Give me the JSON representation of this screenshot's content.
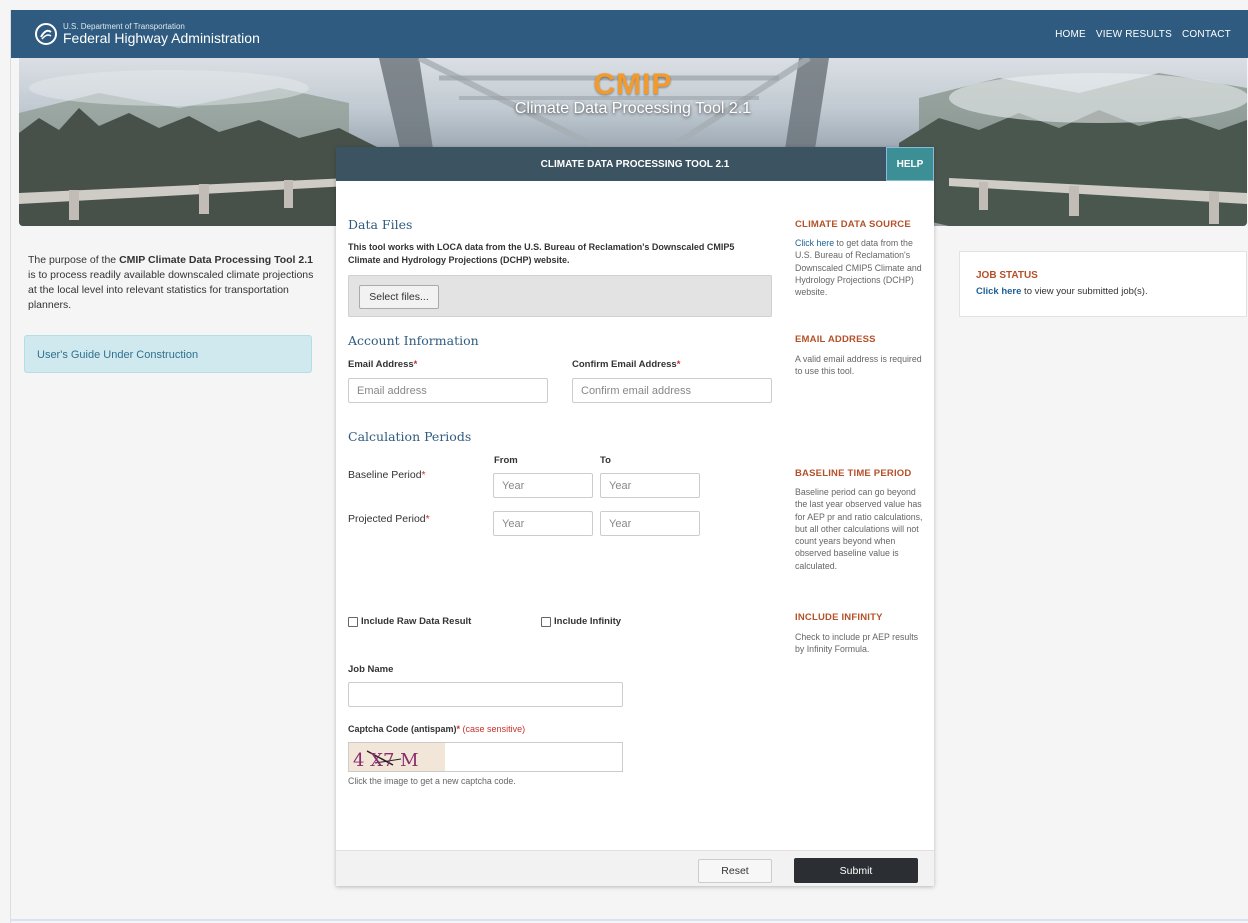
{
  "header": {
    "agency_small": "U.S. Department of Transportation",
    "agency_big": "Federal Highway Administration",
    "nav": [
      "HOME",
      "VIEW RESULTS",
      "CONTACT"
    ]
  },
  "hero": {
    "title": "CMIP",
    "subtitle": "Climate Data Processing Tool 2.1"
  },
  "left": {
    "intro_pre": "The purpose of the ",
    "intro_bold": "CMIP Climate Data Processing Tool 2.1",
    "intro_post": " is to process readily available downscaled climate projections at the local level into relevant statistics for transportation planners.",
    "guide": "User's Guide Under Construction"
  },
  "job_status": {
    "heading": "JOB STATUS",
    "link": "Click here",
    "text": " to view your submitted job(s)."
  },
  "panel": {
    "title": "CLIMATE DATA PROCESSING TOOL 2.1",
    "help": "HELP",
    "data_files": {
      "title": "Data Files",
      "desc": "This tool works with LOCA data from the U.S. Bureau of Reclamation's Downscaled CMIP5 Climate and Hydrology Projections (DCHP) website.",
      "select_button": "Select files..."
    },
    "account": {
      "title": "Account Information",
      "email_label": "Email Address",
      "email_placeholder": "Email address",
      "confirm_label": "Confirm Email Address",
      "confirm_placeholder": "Confirm email address",
      "required_mark": "*"
    },
    "periods": {
      "title": "Calculation Periods",
      "from": "From",
      "to": "To",
      "baseline_label": "Baseline Period",
      "projected_label": "Projected Period",
      "year_placeholder": "Year"
    },
    "options": {
      "raw": "Include Raw Data Result",
      "infinity": "Include Infinity"
    },
    "job_name": {
      "label": "Job Name",
      "value": ""
    },
    "captcha": {
      "label": "Captcha Code (antispam)",
      "case_note": "(case sensitive)",
      "code": "4 X7 M",
      "hint": "Click the image to get a new captcha code."
    },
    "buttons": {
      "reset": "Reset",
      "submit": "Submit"
    },
    "sidebar": {
      "source_head": "CLIMATE DATA SOURCE",
      "source_link": "Click here",
      "source_text": " to get data from the U.S. Bureau of Reclamation's Downscaled CMIP5 Climate and Hydrology Projections (DCHP) website.",
      "email_head": "EMAIL ADDRESS",
      "email_text": "A valid email address is required to use this tool.",
      "baseline_head": "BASELINE TIME PERIOD",
      "baseline_text": "Baseline period can go beyond the last year observed value has for AEP pr and ratio calculations, but all other calculations will not count years beyond when observed baseline value is calculated.",
      "infinity_head": "INCLUDE INFINITY",
      "infinity_text": "Check to include pr AEP results by Infinity Formula."
    }
  },
  "colors": {
    "nav_bg": "#2e5b7f",
    "panel_head": "#3c5361",
    "help_bg": "#3d8f96",
    "accent_orange": "#b5512a",
    "cmip_orange": "#f39a2c"
  }
}
